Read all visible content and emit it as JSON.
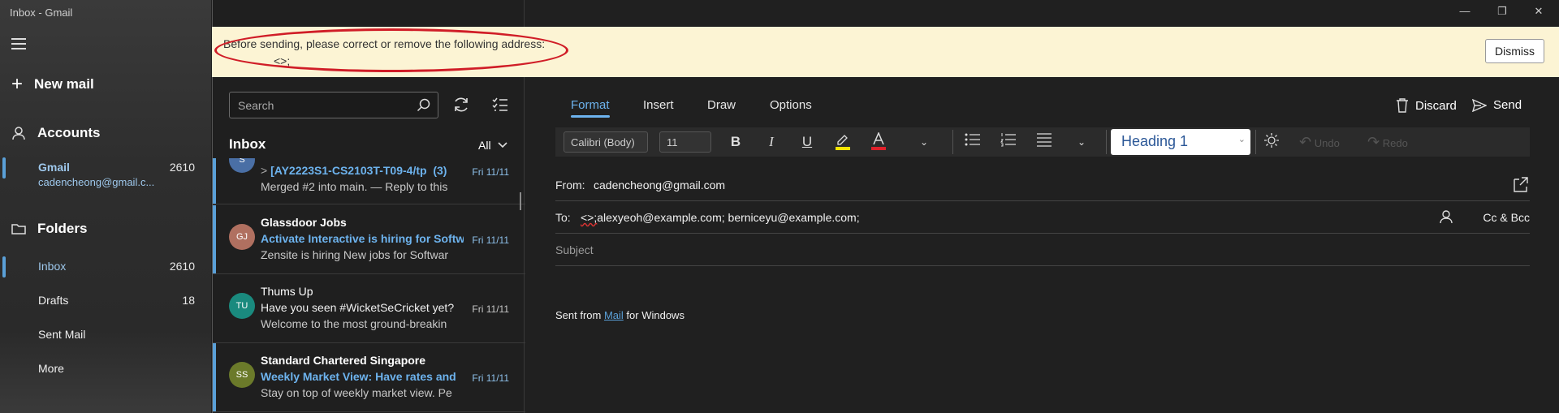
{
  "window": {
    "title": "Inbox - Gmail"
  },
  "nav": {
    "new_mail": "New mail",
    "accounts_heading": "Accounts",
    "account": {
      "name": "Gmail",
      "count": "2610",
      "email": "cadencheong@gmail.c..."
    },
    "folders_heading": "Folders",
    "folders": [
      {
        "label": "Inbox",
        "count": "2610"
      },
      {
        "label": "Drafts",
        "count": "18"
      },
      {
        "label": "Sent Mail",
        "count": ""
      },
      {
        "label": "More",
        "count": ""
      }
    ]
  },
  "list": {
    "search_placeholder": "Search",
    "title": "Inbox",
    "filter": "All",
    "messages": [
      {
        "avatar": "S",
        "avatar_color": "#4a6fa5",
        "sender": "",
        "subject": "[AY2223S1-CS2103T-T09-4/tp",
        "thread_count": "(3)",
        "date": "Fri 11/11",
        "preview": "Merged #2 into main. — Reply to this"
      },
      {
        "avatar": "GJ",
        "avatar_color": "#b07060",
        "sender": "Glassdoor Jobs",
        "subject": "Activate Interactive is hiring for Software",
        "date": "Fri 11/11",
        "preview": "Zensite is hiring New jobs for Softwar"
      },
      {
        "avatar": "TU",
        "avatar_color": "#1a8a7e",
        "sender": "Thums Up",
        "subject": "Have you seen #WicketSeCricket yet?",
        "date": "Fri 11/11",
        "preview": "Welcome to the most ground-breakin"
      },
      {
        "avatar": "SS",
        "avatar_color": "#6b7a2a",
        "sender": "Standard Chartered Singapore",
        "subject": "Weekly Market View: Have rates and",
        "date": "Fri 11/11",
        "preview": "Stay on top of weekly market view. Pe"
      }
    ]
  },
  "banner": {
    "message": "Before sending, please correct or remove the following address:",
    "address": "<>;",
    "dismiss": "Dismiss"
  },
  "compose": {
    "tabs": [
      "Format",
      "Insert",
      "Draw",
      "Options"
    ],
    "discard": "Discard",
    "send": "Send",
    "font_name": "Calibri (Body)",
    "font_size": "11",
    "style": "Heading 1",
    "undo": "Undo",
    "redo": "Redo",
    "from_label": "From:",
    "from_value": "cadencheong@gmail.com",
    "to_label": "To:",
    "to_invalid": "<>;",
    "to_value": "alexyeoh@example.com; berniceyu@example.com;",
    "cc_bcc": "Cc & Bcc",
    "subject_placeholder": "Subject",
    "body_prefix": "Sent from ",
    "body_link": "Mail",
    "body_suffix": " for Windows"
  },
  "colors": {
    "accent": "#6db3ee",
    "banner_bg": "#fcf4d4",
    "annotation_red": "#d01d27",
    "highlight_yellow": "#f5e400",
    "font_color_red": "#e0212b"
  }
}
